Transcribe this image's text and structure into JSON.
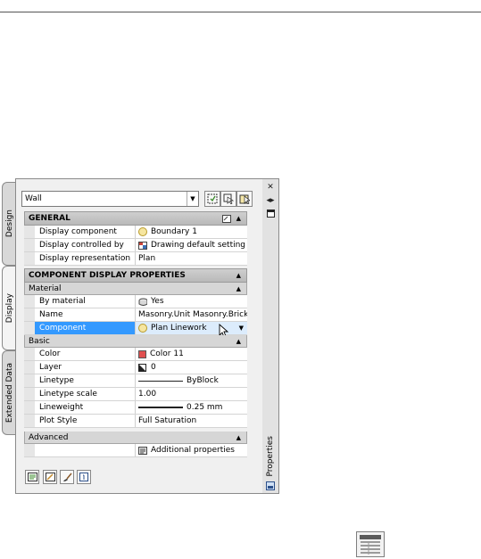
{
  "palette": {
    "tabs": [
      "Design",
      "Display",
      "Extended Data"
    ],
    "object_type": "Wall",
    "side_label": "Properties"
  },
  "sections": {
    "general": {
      "title": "GENERAL",
      "rows": [
        {
          "name": "Display component",
          "value": "Boundary 1"
        },
        {
          "name": "Display controlled by",
          "value": "Drawing default setting"
        },
        {
          "name": "Display representation",
          "value": "Plan"
        }
      ]
    },
    "component_display": {
      "title": "COMPONENT DISPLAY PROPERTIES"
    },
    "material": {
      "title": "Material",
      "rows": [
        {
          "name": "By material",
          "value": "Yes"
        },
        {
          "name": "Name",
          "value": "Masonry.Unit Masonry.Brick..."
        },
        {
          "name": "Component",
          "value": "Plan Linework"
        }
      ]
    },
    "basic": {
      "title": "Basic",
      "rows": [
        {
          "name": "Color",
          "value": "Color 11"
        },
        {
          "name": "Layer",
          "value": "0"
        },
        {
          "name": "Linetype",
          "value": "ByBlock"
        },
        {
          "name": "Linetype scale",
          "value": "1.00"
        },
        {
          "name": "Lineweight",
          "value": "0.25 mm"
        },
        {
          "name": "Plot Style",
          "value": "Full Saturation"
        }
      ]
    },
    "advanced": {
      "title": "Advanced",
      "rows": [
        {
          "name": "",
          "value": "Additional properties"
        }
      ]
    }
  },
  "colors": {
    "selection": "#3399ff",
    "color11_swatch": "#e05050"
  }
}
